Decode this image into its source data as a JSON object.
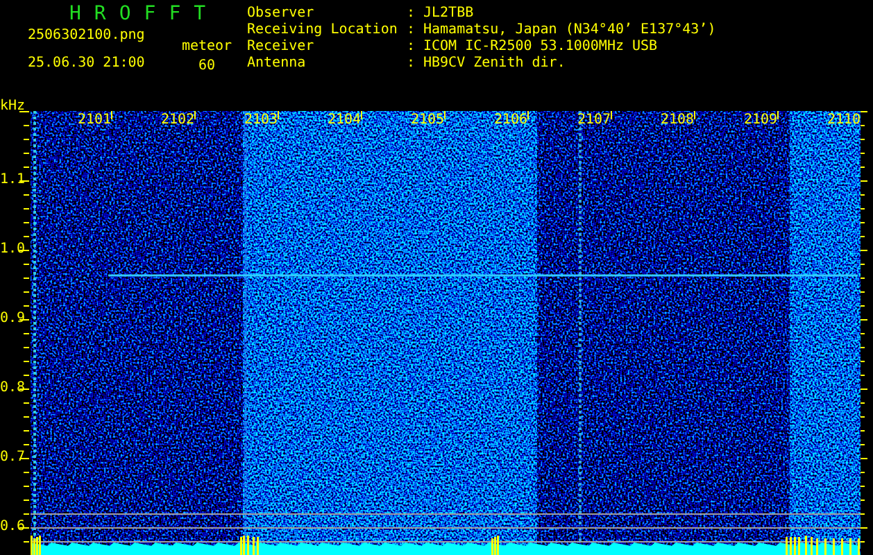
{
  "header": {
    "title": "HROFFT",
    "file_name": "2506302100.png",
    "date_time": "25.06.30 21:00",
    "counter_label": "meteor",
    "counter_value": "60"
  },
  "station_info": [
    {
      "label": "Observer",
      "separator": ":",
      "value": "JL2TBB"
    },
    {
      "label": "Receiving Location",
      "separator": ":",
      "value": "Hamamatsu, Japan (N34°40’ E137°43’)"
    },
    {
      "label": "Receiver",
      "separator": ":",
      "value": "ICOM IC-R2500 53.1000MHz USB"
    },
    {
      "label": "Antenna",
      "separator": ":",
      "value": "HB9CV Zenith dir."
    }
  ],
  "spectrogram": {
    "y_unit": "kHz",
    "y_ticks": [
      "1.1",
      "1.0",
      "0.9",
      "0.8",
      "0.7",
      "0.6"
    ],
    "x_ticks": [
      "2101",
      "2102",
      "2103",
      "2104",
      "2105",
      "2106",
      "2107",
      "2108",
      "2109",
      "2110"
    ]
  }
}
